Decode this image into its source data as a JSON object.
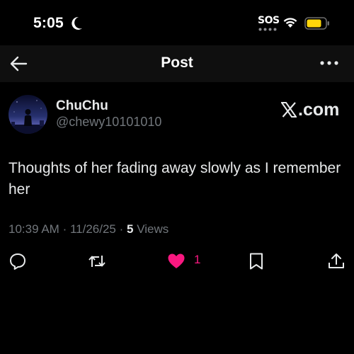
{
  "status_bar": {
    "time": "5:05",
    "sos": "SOS",
    "battery_color": "#ffd60a"
  },
  "header": {
    "title": "Post",
    "back_icon": "arrow-left-icon",
    "more_icon": "more-horizontal-icon"
  },
  "post": {
    "display_name": "ChuChu",
    "handle": "@chewy10101010",
    "brand": ".com",
    "text": "Thoughts of her fading away slowly as I remember her",
    "time": "10:39 AM",
    "separator": "·",
    "date": "11/26/25",
    "views_count": "5",
    "views_label": "Views"
  },
  "actions": {
    "reply_icon": "comment-icon",
    "repost_icon": "repost-icon",
    "like_icon": "heart-icon",
    "like_count": "1",
    "like_color": "#f91880",
    "bookmark_icon": "bookmark-icon",
    "share_icon": "share-icon"
  }
}
